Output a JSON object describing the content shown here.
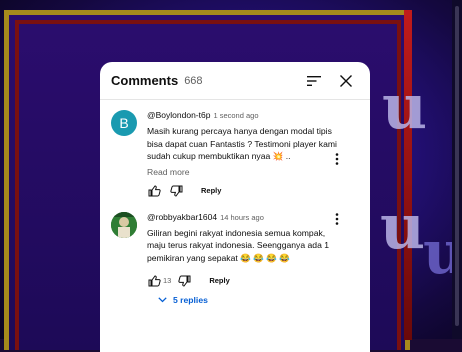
{
  "panel": {
    "title": "Comments",
    "count": "668"
  },
  "comments": [
    {
      "avatar_letter": "B",
      "avatar_color": "#1a9ab0",
      "author": "@Boylondon-t6p",
      "time": "1 second ago",
      "text": "Masih kurang percaya hanya dengan modal tipis bisa dapat cuan Fantastis ? Testimoni player kami sudah cukup membuktikan nyaa 💥 ..",
      "read_more": "Read more",
      "likes": "",
      "reply_label": "Reply"
    },
    {
      "avatar_letter": "",
      "avatar_color": "#1e6b2a",
      "author": "@robbyakbar1604",
      "time": "14 hours ago",
      "text": "Giliran begini rakyat indonesia semua kompak, maju terus rakyat indonesia. Seengganya ada 1 pemikiran yang sepakat 😂 😂 😂 😂",
      "read_more": "",
      "likes": "13",
      "reply_label": "Reply",
      "replies_label": "5 replies"
    }
  ],
  "colors": {
    "link_blue": "#065fd4",
    "frame_gold": "#a68a1c",
    "frame_red": "#c11b1b",
    "bg_purple": "#24107a"
  },
  "icons": [
    "sort-icon",
    "close-icon",
    "thumbs-up-icon",
    "thumbs-down-icon",
    "more-vert-icon",
    "chevron-down-icon"
  ]
}
